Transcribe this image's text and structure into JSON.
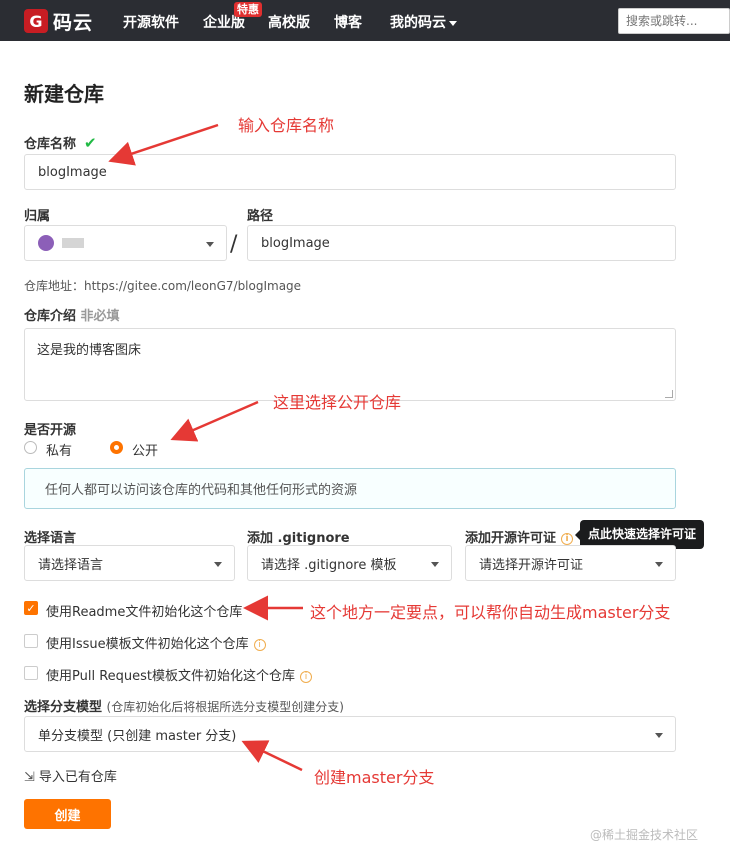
{
  "nav": {
    "logo_mark": "G",
    "logo_text": "码云",
    "items": [
      "开源软件",
      "企业版",
      "高校版",
      "博客",
      "我的码云"
    ],
    "badge": "特惠",
    "search_placeholder": "搜索或跳转..."
  },
  "page": {
    "title": "新建仓库"
  },
  "form": {
    "repo_name_label": "仓库名称",
    "repo_name_value": "blogImage",
    "owner_label": "归属",
    "path_label": "路径",
    "path_value": "blogImage",
    "slash": "/",
    "repo_url": "仓库地址：https://gitee.com/leonG7/blogImage",
    "desc_label": "仓库介绍",
    "desc_optional": "非必填",
    "desc_value": "这是我的博客图床",
    "open_label": "是否开源",
    "radio_private": "私有",
    "radio_public": "公开",
    "info_text": "任何人都可以访问该仓库的代码和其他任何形式的资源",
    "lang_label": "选择语言",
    "lang_value": "请选择语言",
    "gitignore_label": "添加 .gitignore",
    "gitignore_value": "请选择 .gitignore 模板",
    "license_label": "添加开源许可证",
    "license_value": "请选择开源许可证",
    "tooltip": "点此快速选择许可证",
    "cb_readme": "使用Readme文件初始化这个仓库",
    "cb_issue": "使用Issue模板文件初始化这个仓库",
    "cb_pr": "使用Pull Request模板文件初始化这个仓库",
    "branch_label": "选择分支模型",
    "branch_hint": "(仓库初始化后将根据所选分支模型创建分支)",
    "branch_value": "单分支模型 (只创建 master 分支)",
    "import_link": "导入已有仓库",
    "create_button": "创建"
  },
  "annotations": {
    "a1": "输入仓库名称",
    "a2": "这里选择公开仓库",
    "a3": "这个地方一定要点，可以帮你自动生成master分支",
    "a4": "创建master分支"
  },
  "watermark": "@稀土掘金技术社区",
  "colors": {
    "accent": "#fe7300",
    "nav_bg": "#2b2d33",
    "annotation": "#e53935",
    "logo": "#c71d23"
  }
}
